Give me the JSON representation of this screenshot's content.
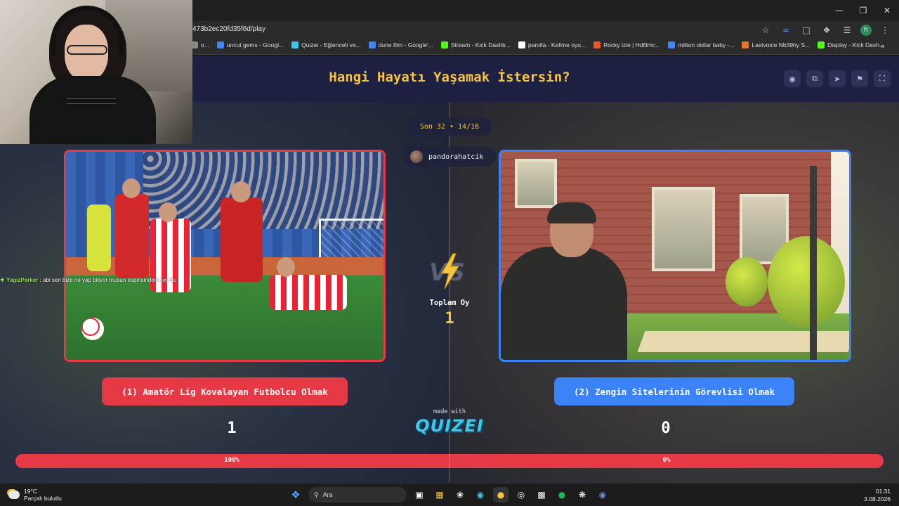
{
  "browser": {
    "url": "473b2ec20fd35f6d/play",
    "bookmarks": [
      {
        "label": "o...",
        "color": "#888888"
      },
      {
        "label": "uncut gems - Googl...",
        "color": "#4285f4"
      },
      {
        "label": "Quizei - Eğlenceli ve...",
        "color": "#3ec6e8"
      },
      {
        "label": "dune film - Google'...",
        "color": "#4285f4"
      },
      {
        "label": "Stream - Kick Dashb...",
        "color": "#53fc18"
      },
      {
        "label": "parolla - Kelime oyu...",
        "color": "#ffffff"
      },
      {
        "label": "Rocky izle | Hdfilmc...",
        "color": "#e85a2a"
      },
      {
        "label": "million dollar baby -...",
        "color": "#4285f4"
      },
      {
        "label": "Lastvoice Nb39hy S...",
        "color": "#e8742a"
      },
      {
        "label": "Display - Kick Dash...",
        "color": "#53fc18"
      }
    ]
  },
  "game": {
    "title": "Hangi Hayatı Yaşamak İstersin?",
    "round": "Son 32 • 14/16",
    "username": "pandorahatcik",
    "total_votes_label": "Toplam Oy",
    "total_votes": "1",
    "vs_label": "VS",
    "option_left": {
      "label": "(1) Amatör Lig Kovalayan Futbolcu Olmak",
      "votes": "1",
      "percent_label": "100%",
      "percent": 100,
      "color": "#e63946"
    },
    "option_right": {
      "label": "(2) Zengin Sitelerinin Görevlisi Olmak",
      "votes": "0",
      "percent_label": "0%",
      "percent": 0,
      "color": "#3b82f6"
    },
    "made_with": "made with",
    "logo": "QUIZEI"
  },
  "chat": {
    "user": "YagizParker",
    "message": " : abi sen bize ne yap biliyor musun espirisindeki şey bu"
  },
  "taskbar": {
    "temperature": "19°C",
    "weather": "Parçalı bulutlu",
    "search": "Ara",
    "time": "01:31",
    "date": "3.08.2026"
  }
}
